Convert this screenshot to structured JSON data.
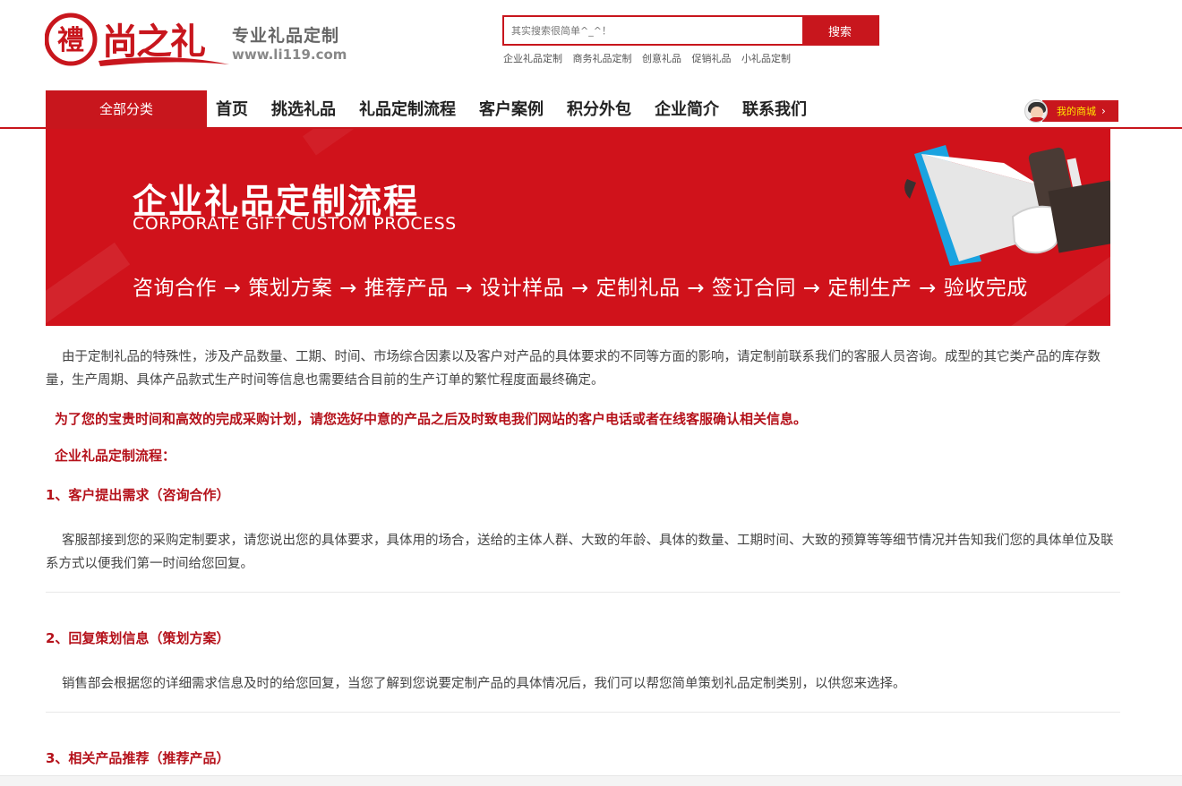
{
  "header": {
    "logo_text": "尚之礼",
    "logo_seal": "禮",
    "slogan_title": "专业礼品定制",
    "slogan_url": "www.li119.com",
    "search_placeholder": "其实搜索很简单^_^！",
    "search_button": "搜索",
    "hot_words": [
      "企业礼品定制",
      "商务礼品定制",
      "创意礼品",
      "促销礼品",
      "小礼品定制"
    ]
  },
  "nav": {
    "all_categories": "全部分类",
    "items": [
      "首页",
      "挑选礼品",
      "礼品定制流程",
      "客户案例",
      "积分外包",
      "企业简介",
      "联系我们"
    ],
    "my_shop": "我的商城",
    "my_shop_arrow": "›"
  },
  "banner": {
    "title": "企业礼品定制流程",
    "subtitle": "CORPORATE GIFT CUSTOM PROCESS",
    "flow": "咨询合作 → 策划方案 → 推荐产品 → 设计样品 → 定制礼品 → 签订合同 → 定制生产 → 验收完成"
  },
  "content": {
    "intro": "由于定制礼品的特殊性，涉及产品数量、工期、时间、市场综合因素以及客户对产品的具体要求的不同等方面的影响，请定制前联系我们的客服人员咨询。成型的其它类产品的库存数量，生产周期、具体产品款式生产时间等信息也需要结合目前的生产订单的繁忙程度面最终确定。",
    "notice": "为了您的宝贵时间和高效的完成采购计划，请您选好中意的产品之后及时致电我们网站的客户电话或者在线客服确认相关信息。",
    "flow_title": "企业礼品定制流程：",
    "steps": [
      {
        "title": "1、客户提出需求（咨询合作）",
        "body": "客服部接到您的采购定制要求，请您说出您的具体要求，具体用的场合，送给的主体人群、大致的年龄、具体的数量、工期时间、大致的预算等等细节情况并告知我们您的具体单位及联系方式以便我们第一时间给您回复。"
      },
      {
        "title": "2、回复策划信息（策划方案）",
        "body": "销售部会根据您的详细需求信息及时的给您回复，当您了解到您说要定制产品的具体情况后，我们可以帮您简单策划礼品定制类别，以供您来选择。"
      },
      {
        "title": "3、相关产品推荐（推荐产品）",
        "body": ""
      }
    ]
  },
  "colors": {
    "brand_red": "#c8161d",
    "title_red": "#b5121b",
    "hot_yellow": "#ffe400"
  }
}
